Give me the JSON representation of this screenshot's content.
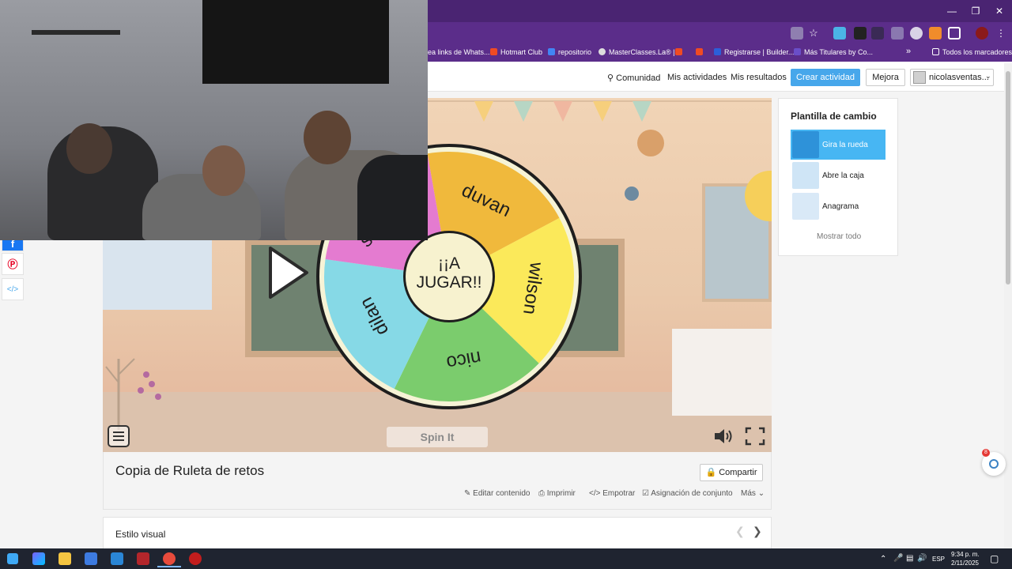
{
  "bookmarks": [
    {
      "label": "ea links de Whats...",
      "color": "#3ab04a"
    },
    {
      "label": "Hotmart Club",
      "color": "#ef4b23"
    },
    {
      "label": "repositorio",
      "color": "#4285f4"
    },
    {
      "label": "MasterClasses.La® |...",
      "color": "#dddddd"
    },
    {
      "label": "Registrarse | Builder...",
      "color": "#2b5fd9"
    },
    {
      "label": "Más Titulares by Co...",
      "color": "#6a4ec8"
    }
  ],
  "bookmarks_all": "Todos los marcadores",
  "header": {
    "community": "Comunidad",
    "my_activities": "Mis actividades",
    "my_results": "Mis resultados",
    "create": "Crear actividad",
    "upgrade": "Mejora",
    "user": "nicolasventas..."
  },
  "activity": {
    "wheel_center": "¡¡A JUGAR!!",
    "wheel_center_line1": "¡¡A",
    "wheel_center_line2": "JUGAR!!",
    "segments": [
      {
        "label": "duvan",
        "color": "#f0b93c"
      },
      {
        "label": "wilson",
        "color": "#fbe95a"
      },
      {
        "label": "nico",
        "color": "#7bcc6d"
      },
      {
        "label": "dilan",
        "color": "#86d9e6"
      },
      {
        "label": "se repite",
        "color": "#e47bd0"
      }
    ],
    "spin_label": "Spin It",
    "title": "Copia de Ruleta de retos",
    "share": "Compartir",
    "actions": [
      "Editar contenido",
      "Imprimir",
      "Empotrar",
      "Asignación de conjunto",
      "Más"
    ],
    "visual_style": "Estilo visual"
  },
  "templates": {
    "title": "Plantilla de cambio",
    "items": [
      {
        "label": "Gira la rueda",
        "selected": true
      },
      {
        "label": "Abre la caja",
        "selected": false
      },
      {
        "label": "Anagrama",
        "selected": false
      }
    ],
    "show_all": "Mostrar todo"
  },
  "chat_badge": "8",
  "taskbar": {
    "lang": "ESP",
    "time": "9:34 p. m.",
    "date": "2/11/2025"
  },
  "colors": {
    "title_bar": "#4a2472",
    "toolbar": "#5b2d8a",
    "accent": "#47a7eb"
  }
}
